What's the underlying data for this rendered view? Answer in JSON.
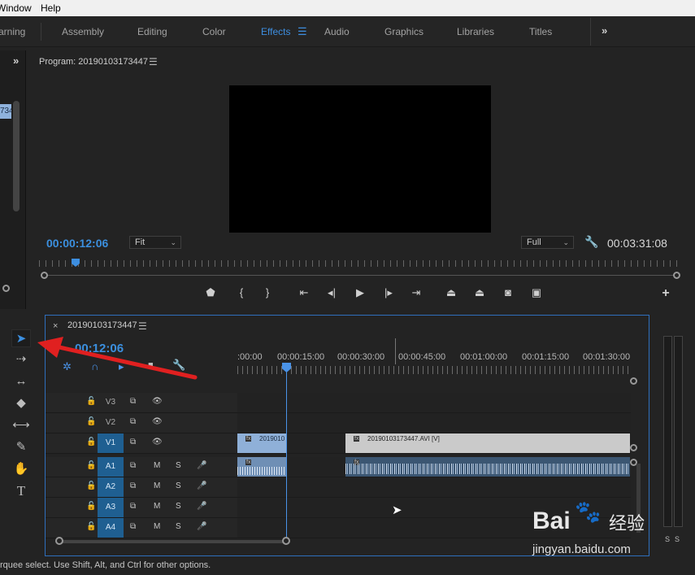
{
  "menubar": {
    "items": [
      "Window",
      "Help"
    ]
  },
  "workspaces": {
    "items": [
      {
        "label": "arning"
      },
      {
        "label": "Assembly"
      },
      {
        "label": "Editing"
      },
      {
        "label": "Color"
      },
      {
        "label": "Effects"
      },
      {
        "label": "Audio"
      },
      {
        "label": "Graphics"
      },
      {
        "label": "Libraries"
      },
      {
        "label": "Titles"
      }
    ],
    "active": "Effects",
    "overflow_icon": "double-chevron-right-icon"
  },
  "left_panel": {
    "clip_fragment": "734"
  },
  "program": {
    "title": "Program: 20190103173447",
    "current_time": "00:00:12:06",
    "fit": "Fit",
    "quality": "Full",
    "duration": "00:03:31:08",
    "controls": [
      "marker-icon",
      "mark-in-icon",
      "mark-out-icon",
      "go-to-in-icon",
      "step-back-icon",
      "play-icon",
      "step-forward-icon",
      "go-to-out-icon",
      "lift-icon",
      "extract-icon",
      "export-frame-icon",
      "compare-icon",
      "add-icon"
    ]
  },
  "tools": [
    "selection-tool-icon",
    "track-select-tool-icon",
    "ripple-edit-tool-icon",
    "razor-tool-icon",
    "slip-tool-icon",
    "pen-tool-icon",
    "hand-tool-icon",
    "type-tool-icon"
  ],
  "timeline": {
    "close": "×",
    "sequence": "20190103173447",
    "timecode": "00:12:06",
    "ruler": [
      ":00:00",
      "00:00:15:00",
      "00:00:30:00",
      "00:00:45:00",
      "00:01:00:00",
      "00:01:15:00",
      "00:01:30:00"
    ],
    "video_tracks": [
      {
        "name": "V3",
        "on": false
      },
      {
        "name": "V2",
        "on": false
      },
      {
        "name": "V1",
        "on": true
      }
    ],
    "audio_tracks": [
      {
        "name": "A1",
        "on": true
      },
      {
        "name": "A2",
        "on": true
      },
      {
        "name": "A3",
        "on": true
      },
      {
        "name": "A4",
        "on": true
      }
    ],
    "mute_label": "M",
    "solo_label": "S",
    "clips": {
      "v1_a": "2019010",
      "v1_b": "20190103173447.AVI [V]"
    }
  },
  "meters": {
    "solo_a": "S",
    "solo_b": "S"
  },
  "status": "rquee select. Use Shift, Alt, and Ctrl for other options.",
  "watermark": {
    "brand": "Bai",
    "brand2": "经验",
    "url": "jingyan.baidu.com"
  },
  "colors": {
    "accent": "#3d8ee0",
    "track_on": "#1f5f91",
    "clip_video": "#c9c9c9",
    "clip_audio": "#3b5672",
    "arrow": "#e02020"
  }
}
